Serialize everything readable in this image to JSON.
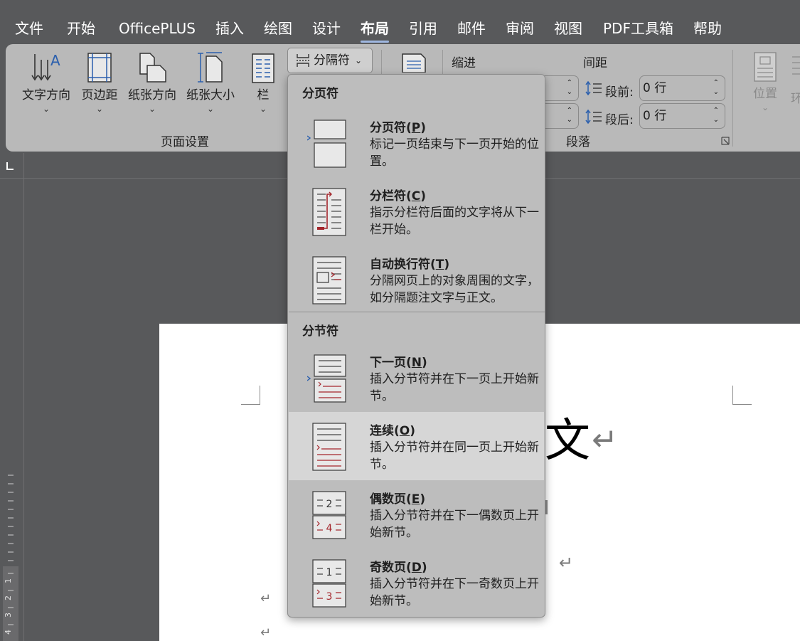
{
  "menu": {
    "items": [
      {
        "label": "文件"
      },
      {
        "label": "开始"
      },
      {
        "label": "OfficePLUS"
      },
      {
        "label": "插入"
      },
      {
        "label": "绘图"
      },
      {
        "label": "设计"
      },
      {
        "label": "布局",
        "active": true
      },
      {
        "label": "引用"
      },
      {
        "label": "邮件"
      },
      {
        "label": "审阅"
      },
      {
        "label": "视图"
      },
      {
        "label": "PDF工具箱"
      },
      {
        "label": "帮助"
      }
    ]
  },
  "ribbon": {
    "page_setup": {
      "text_direction": "文字方向",
      "margins": "页边距",
      "orientation": "纸张方向",
      "size": "纸张大小",
      "columns": "栏",
      "breaks": "分隔符",
      "group_label": "页面设置"
    },
    "paragraph": {
      "indent_label": "缩进",
      "spacing_label": "间距",
      "before_label": "段前:",
      "before_value": "0 行",
      "after_label": "段后:",
      "after_value": "0 行",
      "group_label": "段落"
    },
    "arrange": {
      "position": "位置",
      "wrap_partial": "环"
    }
  },
  "document": {
    "visible_char": "文",
    "para_mark": "↵",
    "ruler_numbers": [
      "1",
      "2",
      "3",
      "4"
    ]
  },
  "dropdown": {
    "page_breaks_header": "分页符",
    "section_breaks_header": "分节符",
    "items": [
      {
        "title": "分页符(",
        "key": "P",
        "title_end": ")",
        "desc": "标记一页结束与下一页开始的位置。"
      },
      {
        "title": "分栏符(",
        "key": "C",
        "title_end": ")",
        "desc": "指示分栏符后面的文字将从下一栏开始。"
      },
      {
        "title": "自动换行符(",
        "key": "T",
        "title_end": ")",
        "desc": "分隔网页上的对象周围的文字，如分隔题注文字与正文。"
      },
      {
        "title": "下一页(",
        "key": "N",
        "title_end": ")",
        "desc": "插入分节符并在下一页上开始新节。"
      },
      {
        "title": "连续(",
        "key": "O",
        "title_end": ")",
        "desc": "插入分节符并在同一页上开始新节。"
      },
      {
        "title": "偶数页(",
        "key": "E",
        "title_end": ")",
        "desc": "插入分节符并在下一偶数页上开始新节。"
      },
      {
        "title": "奇数页(",
        "key": "D",
        "title_end": ")",
        "desc": "插入分节符并在下一奇数页上开始新节。"
      }
    ]
  },
  "colors": {
    "menubar_bg": "#58595b",
    "ribbon_bg": "#b9b9b9",
    "dropdown_bg": "#bdbdbd",
    "hover_bg": "#d6d6d6",
    "accent_red": "#a4262c",
    "accent_blue": "#2b5fad"
  }
}
